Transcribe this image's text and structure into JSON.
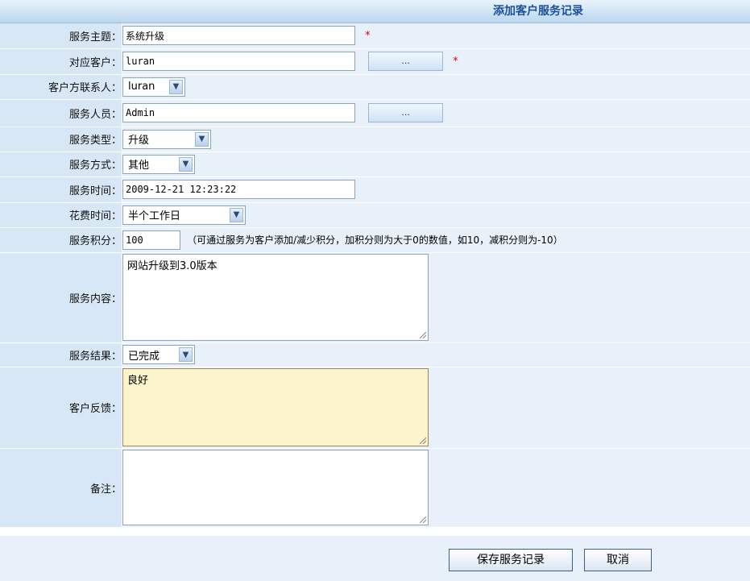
{
  "header": {
    "title": "添加客户服务记录"
  },
  "fields": {
    "subject": {
      "label": "服务主题：",
      "value": "系统升级"
    },
    "customer": {
      "label": "对应客户：",
      "value": "luran",
      "button": "..."
    },
    "contact": {
      "label": "客户方联系人：",
      "selected": "luran"
    },
    "staff": {
      "label": "服务人员：",
      "value": "Admin",
      "button": "..."
    },
    "type": {
      "label": "服务类型：",
      "selected": "升级"
    },
    "method": {
      "label": "服务方式：",
      "selected": "其他"
    },
    "time": {
      "label": "服务时间：",
      "value": "2009-12-21 12:23:22"
    },
    "cost": {
      "label": "花费时间：",
      "selected": "半个工作日"
    },
    "points": {
      "label": "服务积分：",
      "value": "100",
      "note": "（可通过服务为客户添加/减少积分，加积分则为大于0的数值，如10，减积分则为-10）"
    },
    "content": {
      "label": "服务内容：",
      "value": "网站升级到3.0版本"
    },
    "result": {
      "label": "服务结果：",
      "selected": "已完成"
    },
    "feedback": {
      "label": "客户反馈：",
      "value": "良好"
    },
    "remark": {
      "label": "备注：",
      "value": ""
    }
  },
  "required_mark": "*",
  "buttons": {
    "save": "保存服务记录",
    "cancel": "取消"
  },
  "colors": {
    "label_bg": "#d7e7f6",
    "field_bg": "#e8f1fa",
    "title": "#1a4f9a",
    "required": "#e00000",
    "feedback_bg": "#fbf4cd"
  }
}
